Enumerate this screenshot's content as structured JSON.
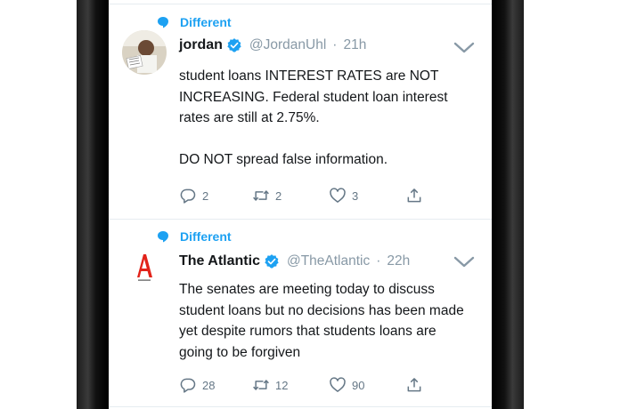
{
  "colors": {
    "accent": "#1da1f2",
    "secondary_text": "#8899a6",
    "text": "#14171a"
  },
  "tweets": [
    {
      "context_label": "Different",
      "display_name": "jordan",
      "verified": true,
      "handle": "@JordanUhl",
      "separator": "·",
      "time": "21h",
      "text": "student loans INTEREST RATES are NOT INCREASING. Federal student loan interest rates are still at 2.75%.\n\nDO NOT spread false information.",
      "replies": "2",
      "retweets": "2",
      "likes": "3"
    },
    {
      "context_label": "Different",
      "display_name": "The Atlantic",
      "verified": true,
      "handle": "@TheAtlantic",
      "separator": "·",
      "time": "22h",
      "text": "The senates are meeting today to discuss student loans but no decisions has been made yet despite rumors that students loans are going to be forgiven",
      "replies": "28",
      "retweets": "12",
      "likes": "90"
    }
  ],
  "icons": {
    "context": "speech-bubble-icon",
    "verified": "verified-badge-icon",
    "menu": "chevron-down-icon",
    "reply": "reply-icon",
    "retweet": "retweet-icon",
    "like": "heart-icon",
    "share": "share-icon"
  }
}
